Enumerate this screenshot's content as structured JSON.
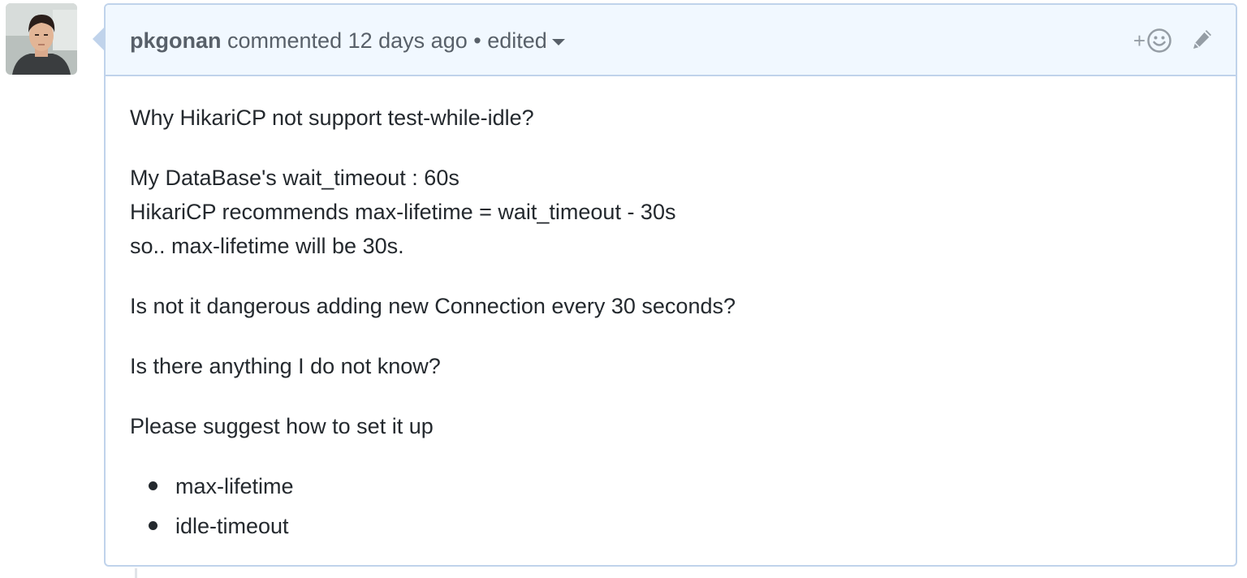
{
  "comment": {
    "author": "pkgonan",
    "action": "commented",
    "time": "12 days ago",
    "separator": "•",
    "edited_label": "edited",
    "icons": {
      "avatar": "user-avatar-photo",
      "reaction": "smiley-plus-icon",
      "edit": "pencil-icon",
      "edited_dropdown": "caret-down-icon"
    },
    "reaction_plus": "+",
    "paragraphs": [
      "Why HikariCP not support test-while-idle?",
      "Is not it dangerous adding new Connection every 30 seconds?",
      "Is there anything I do not know?",
      "Please suggest how to set it up"
    ],
    "multiline": [
      "My DataBase's wait_timeout : 60s",
      "HikariCP recommends max-lifetime = wait_timeout - 30s",
      "so.. max-lifetime will be 30s."
    ],
    "list_items": [
      "max-lifetime",
      "idle-timeout"
    ]
  },
  "colors": {
    "header_bg": "#f1f8ff",
    "border": "#c0d3eb",
    "meta_text": "#586069",
    "body_text": "#24292e"
  }
}
